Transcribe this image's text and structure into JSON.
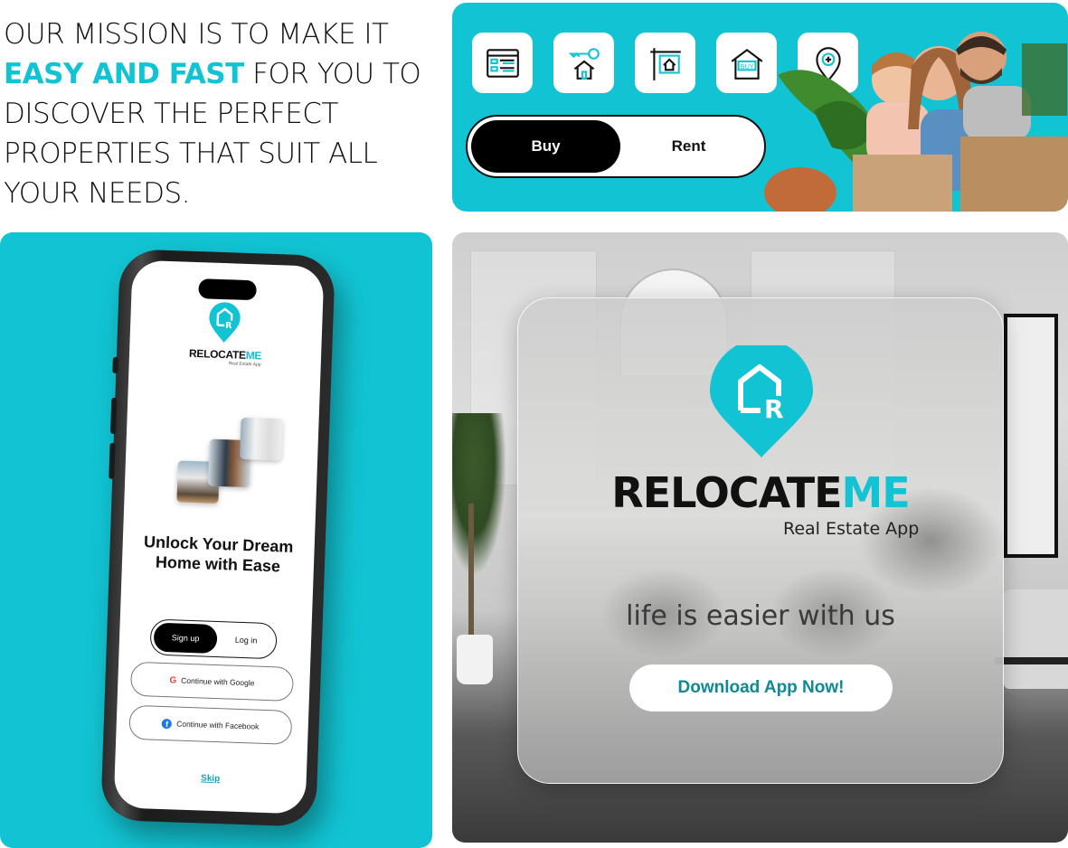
{
  "mission": {
    "line_prefix": "OUR MISSION IS TO MAKE IT",
    "highlight": "EASY AND FAST",
    "line_suffix": "FOR YOU TO DISCOVER THE PERFECT PROPERTIES THAT SUIT ALL YOUR NEEDS."
  },
  "banner": {
    "icons": [
      "listing-icon",
      "house-key-icon",
      "house-sign-icon",
      "buy-house-icon",
      "location-add-icon"
    ],
    "buy_label_on_icon": "BUY",
    "toggle": {
      "active": "Buy",
      "inactive": "Rent"
    }
  },
  "phone": {
    "brand_main": "RELOCATE",
    "brand_accent": "ME",
    "brand_sub": "Real Estate App",
    "headline_line1": "Unlock Your Dream",
    "headline_line2": "Home with Ease",
    "toggle": {
      "active": "Sign up",
      "inactive": "Log in"
    },
    "google_label": "Continue with Google",
    "facebook_label": "Continue with Facebook",
    "skip_label": "Skip"
  },
  "promo": {
    "brand_main": "RELOCATE",
    "brand_accent": "ME",
    "brand_sub": "Real Estate App",
    "tagline": "life is easier with us",
    "cta_label": "Download App Now!"
  },
  "colors": {
    "accent": "#12c4d3",
    "cta_text": "#0d8a93",
    "dark": "#111111"
  }
}
